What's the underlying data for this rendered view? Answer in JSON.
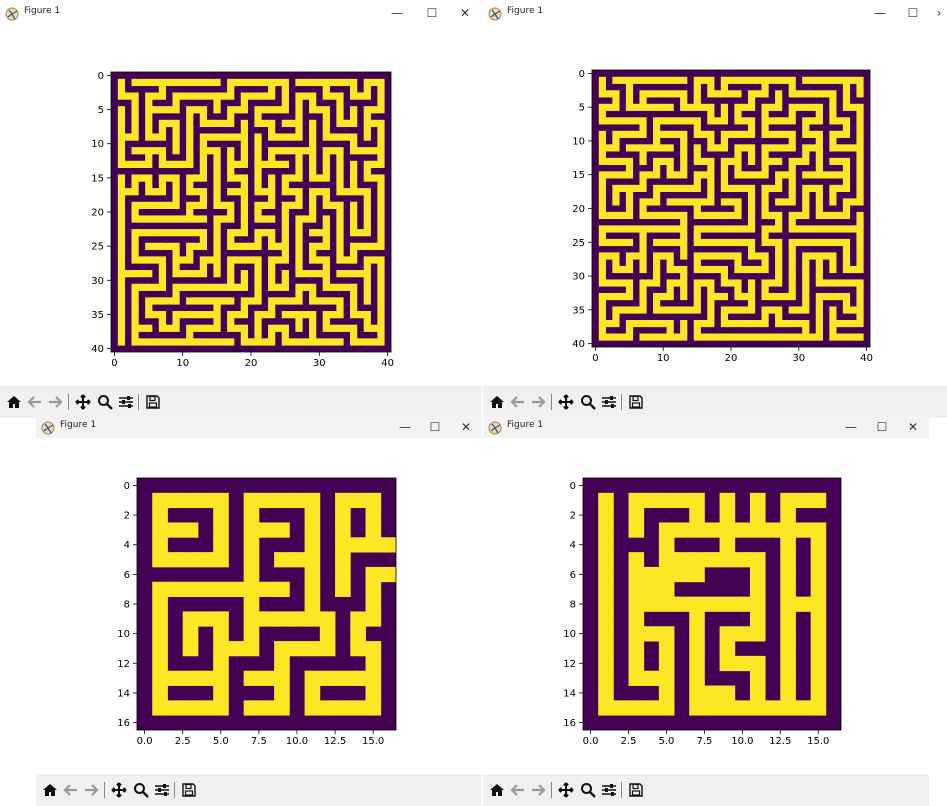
{
  "windows": [
    {
      "id": "w1",
      "title": "Figure 1",
      "chart_data": {
        "type": "heatmap",
        "title": "",
        "xlabel": "",
        "ylabel": "",
        "x_ticks": [
          "0",
          "10",
          "20",
          "30",
          "40"
        ],
        "y_ticks": [
          "0",
          "5",
          "10",
          "15",
          "20",
          "25",
          "30",
          "35",
          "40"
        ],
        "xlim": [
          0,
          40
        ],
        "ylim": [
          40,
          0
        ],
        "grid_size": 41,
        "colormap": "viridis",
        "colors": {
          "wall": "#440154",
          "path": "#fde725"
        }
      }
    },
    {
      "id": "w2",
      "title": "Figure 1",
      "chart_data": {
        "type": "heatmap",
        "title": "",
        "xlabel": "",
        "ylabel": "",
        "x_ticks": [
          "0",
          "10",
          "20",
          "30",
          "40"
        ],
        "y_ticks": [
          "0",
          "5",
          "10",
          "15",
          "20",
          "25",
          "30",
          "35",
          "40"
        ],
        "xlim": [
          0,
          40
        ],
        "ylim": [
          40,
          0
        ],
        "grid_size": 41,
        "colormap": "viridis",
        "colors": {
          "wall": "#440154",
          "path": "#fde725"
        }
      }
    },
    {
      "id": "w3",
      "title": "Figure 1",
      "chart_data": {
        "type": "heatmap",
        "title": "",
        "xlabel": "",
        "ylabel": "",
        "x_ticks": [
          "0.0",
          "2.5",
          "5.0",
          "7.5",
          "10.0",
          "12.5",
          "15.0"
        ],
        "y_ticks": [
          "0",
          "2",
          "4",
          "6",
          "8",
          "10",
          "12",
          "14",
          "16"
        ],
        "xlim": [
          0,
          16
        ],
        "ylim": [
          16,
          0
        ],
        "grid_size": 17,
        "colormap": "viridis",
        "colors": {
          "wall": "#440154",
          "path": "#fde725"
        },
        "values": [
          "00000000000000000",
          "01111101111101110",
          "01000101000101010",
          "01110101110101010",
          "01000101000101111",
          "01111101011101000",
          "00000001000101011",
          "01111111110101010",
          "01000001000100010",
          "01011101111110110",
          "01010101000010100",
          "01010111011110110",
          "01000100010000010",
          "01111101110111110",
          "01000100010100010",
          "01111101110111110",
          "00000000000000000"
        ]
      }
    },
    {
      "id": "w4",
      "title": "Figure 1",
      "chart_data": {
        "type": "heatmap",
        "title": "",
        "xlabel": "",
        "ylabel": "",
        "x_ticks": [
          "0.0",
          "2.5",
          "5.0",
          "7.5",
          "10.0",
          "12.5",
          "15.0"
        ],
        "y_ticks": [
          "0",
          "2",
          "4",
          "6",
          "8",
          "10",
          "12",
          "14",
          "16"
        ],
        "xlim": [
          0,
          16
        ],
        "ylim": [
          16,
          0
        ],
        "grid_size": 17,
        "colormap": "viridis",
        "colors": {
          "wall": "#440154",
          "path": "#fde725"
        },
        "values": [
          "00000000000000000",
          "01011111010101110",
          "01010001010101000",
          "01010111111111110",
          "01000100010001010",
          "01010111111101010",
          "01011111000101010",
          "01011100000101010",
          "01011111111101110",
          "01010001000101010",
          "01011101011101010",
          "01010101010001010",
          "01010101011101010",
          "01011101000101010",
          "01000101110101010",
          "01111101111111110",
          "00000000000000000"
        ]
      }
    }
  ],
  "icons": [
    "home-icon",
    "back-icon",
    "forward-icon",
    "pan-icon",
    "zoom-icon",
    "configure-icon",
    "save-icon"
  ]
}
